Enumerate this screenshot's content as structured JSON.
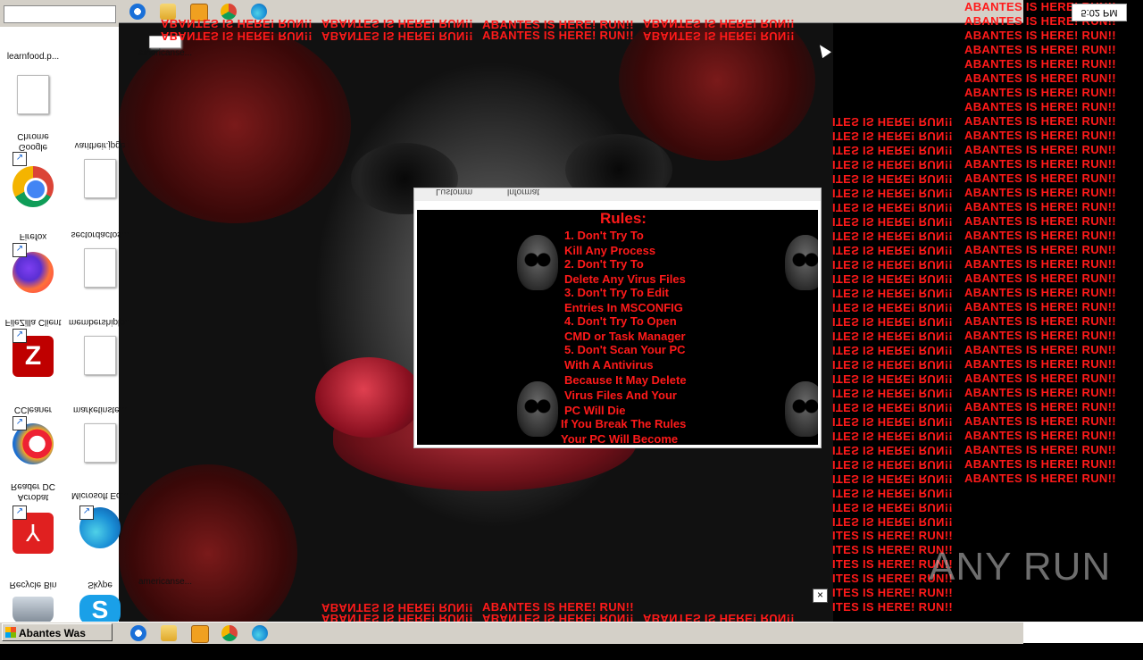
{
  "desktop_icons": [
    {
      "label": "learnfood.p...",
      "icon": "document-icon"
    },
    {
      "label": "Google Chrome",
      "icon": "chrome-icon"
    },
    {
      "label": "varitheir.jpge",
      "icon": "document-icon"
    },
    {
      "label": "Firefox",
      "icon": "firefox-icon"
    },
    {
      "label": "sectordactos...",
      "icon": "document-icon"
    },
    {
      "label": "FileZilla Client",
      "icon": "filezilla-icon"
    },
    {
      "label": "membershiplp...",
      "icon": "document-icon"
    },
    {
      "label": "CCleaner",
      "icon": "ccleaner-icon"
    },
    {
      "label": "marketinste...",
      "icon": "document-icon"
    },
    {
      "label": "Acrobat Reader DC",
      "icon": "acrobat-icon"
    },
    {
      "label": "Microsoft Ed...",
      "icon": "edge-icon"
    },
    {
      "label": "Recycle Bin",
      "icon": "recycle-bin-icon"
    },
    {
      "label": "Skype",
      "icon": "skype-icon"
    },
    {
      "label": "americanse...",
      "icon": "document-icon"
    }
  ],
  "clock": "5:02 PM",
  "spam_text": "ABANTES IS HERE! RUN!!",
  "spam_text_cut": "ITES IS HERE! RUN!!",
  "rules_window": {
    "title_left": "Lustomm",
    "title_right": "lnformat",
    "heading": "Rules:",
    "lines": [
      "1. Don't Try To",
      "Kill Any Process",
      "2. Don't Try To",
      "Delete Any Virus Files",
      "3. Don't Try To Edit",
      "Entries In MSCONFIG",
      "4. Don't Try To Open",
      "CMD or Task Manager",
      "5. Don't Scan Your PC",
      "With A Antivirus",
      "Because It May Delete",
      "Virus Files And Your",
      "PC Will Die",
      "If You Break The Rules",
      "Your PC Will Become"
    ]
  },
  "taskbar": {
    "start_label": "Abantes Was Here",
    "close_glyph": "×",
    "pinned": [
      "internet-explorer-icon",
      "folder-icon",
      "media-player-icon",
      "chrome-icon",
      "edge-icon"
    ]
  },
  "watermark": "ANY RUN"
}
